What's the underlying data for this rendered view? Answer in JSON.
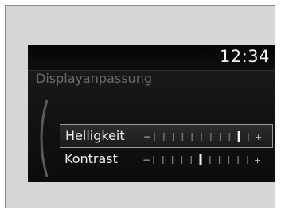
{
  "screen": {
    "clock": "12:34",
    "title": "Displayanpassung"
  },
  "settings": [
    {
      "label": "Helligkeit",
      "level": 10,
      "steps": 11,
      "selected": true,
      "minus_symbol": "−",
      "plus_symbol": "+"
    },
    {
      "label": "Kontrast",
      "level": 6,
      "steps": 11,
      "selected": false,
      "minus_symbol": "−",
      "plus_symbol": "+"
    }
  ],
  "colors": {
    "tick": "#6f6f6f",
    "marker": "#f4f4f4",
    "symbol": "#bdbdbd"
  }
}
